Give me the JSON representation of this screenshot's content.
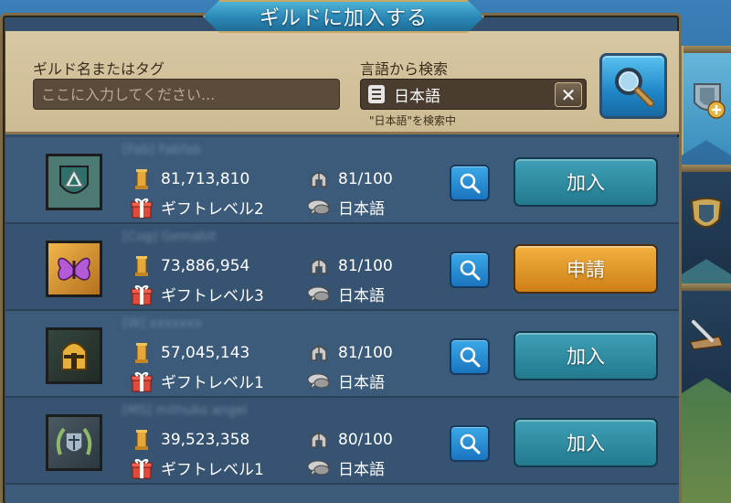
{
  "header": {
    "title": "ギルドに加入する"
  },
  "search": {
    "name_label": "ギルド名またはタグ",
    "name_placeholder": "ここに入力してください...",
    "language_label": "言語から検索",
    "language_value": "日本語",
    "clear_label": "✕",
    "searching_note": "\"日本語\"を検索中"
  },
  "guilds": [
    {
      "name": "[Fab] Fabfab",
      "power": "81,713,810",
      "gift": "ギフトレベル2",
      "members": "81/100",
      "language": "日本語",
      "action": "加入",
      "emblem": "shield-emblem"
    },
    {
      "name": "[Cog] Gemabit",
      "power": "73,886,954",
      "gift": "ギフトレベル3",
      "members": "81/100",
      "language": "日本語",
      "action": "申請",
      "emblem": "butterfly-emblem"
    },
    {
      "name": "[W] xxxxxxx",
      "power": "57,045,143",
      "gift": "ギフトレベル1",
      "members": "81/100",
      "language": "日本語",
      "action": "加入",
      "emblem": "helmet-emblem"
    },
    {
      "name": "[MS] mithuko angel",
      "power": "39,523,358",
      "gift": "ギフトレベル1",
      "members": "80/100",
      "language": "日本語",
      "action": "加入",
      "emblem": "laurel-emblem"
    }
  ],
  "colors": {
    "join_button": "#2a8aa0",
    "apply_button": "#e39a2a",
    "search_blue": "#1f86c8",
    "panel_tan": "#d2c29c"
  },
  "side_tabs": [
    "join-guild-tab",
    "guild-tab",
    "guild-misc-tab"
  ]
}
